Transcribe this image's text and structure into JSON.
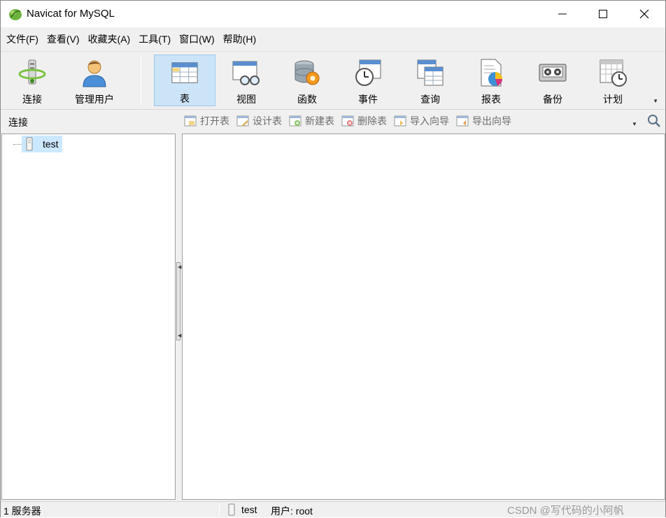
{
  "window": {
    "title": "Navicat for MySQL"
  },
  "menu": [
    {
      "label": "文件(F)"
    },
    {
      "label": "查看(V)"
    },
    {
      "label": "收藏夹(A)"
    },
    {
      "label": "工具(T)"
    },
    {
      "label": "窗口(W)"
    },
    {
      "label": "帮助(H)"
    }
  ],
  "toolbar": {
    "connect": "连接",
    "manage_users": "管理用户",
    "table": "表",
    "view": "视图",
    "function": "函数",
    "event": "事件",
    "query": "查询",
    "report": "报表",
    "backup": "备份",
    "schedule": "计划",
    "active": "表"
  },
  "subbar": {
    "connection_label": "连接",
    "open_table": "打开表",
    "design_table": "设计表",
    "new_table": "新建表",
    "delete_table": "删除表",
    "import_wizard": "导入向导",
    "export_wizard": "导出向导"
  },
  "tree": {
    "connections": [
      {
        "name": "test",
        "selected": true
      }
    ]
  },
  "statusbar": {
    "servers": "1 服务器",
    "database": "test",
    "user": "用户: root",
    "watermark": "CSDN @写代码的小阿帆"
  },
  "colors": {
    "selection": "#cce8ff",
    "active_tool": "#cce4f7",
    "disabled_text": "#6d6d6d"
  }
}
